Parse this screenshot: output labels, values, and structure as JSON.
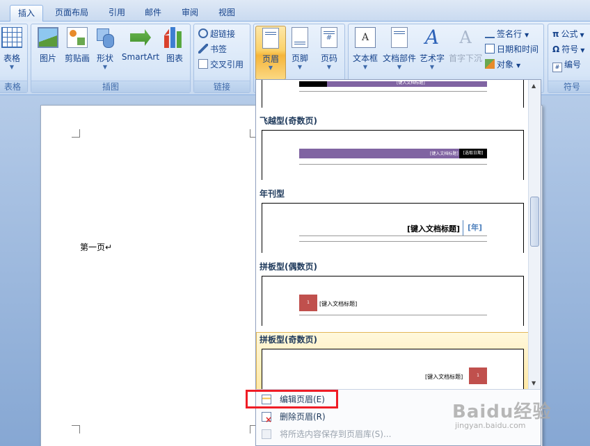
{
  "tabs": [
    {
      "label": "插入",
      "active": true
    },
    {
      "label": "页面布局"
    },
    {
      "label": "引用"
    },
    {
      "label": "邮件"
    },
    {
      "label": "审阅"
    },
    {
      "label": "视图"
    }
  ],
  "ribbon": {
    "table": {
      "label": "表格",
      "group": "表格"
    },
    "illustrations": {
      "group": "插图",
      "picture": "图片",
      "clipart": "剪贴画",
      "shapes": "形状",
      "smartart": "SmartArt",
      "chart": "图表"
    },
    "links": {
      "group": "链接",
      "hyperlink": "超链接",
      "bookmark": "书签",
      "crossref": "交叉引用"
    },
    "header_footer": {
      "header": "页眉",
      "footer": "页脚",
      "pagenumber": "页码"
    },
    "text": {
      "textbox": "文本框",
      "quickparts": "文档部件",
      "wordart": "艺术字",
      "dropcap": "首字下沉",
      "signature": "签名行",
      "datetime": "日期和时间",
      "object": "对象"
    },
    "symbols": {
      "group": "符号",
      "equation": "公式",
      "symbol": "符号",
      "number": "编号"
    }
  },
  "document": {
    "text": "第一页↵"
  },
  "gallery": {
    "items": [
      {
        "title": "飞越型(奇数页)",
        "preview": [
          "[键入文档标题]",
          "[选取日期]"
        ]
      },
      {
        "title": "年刊型",
        "preview": [
          "[键入文档标题]",
          "[年]"
        ]
      },
      {
        "title": "拼板型(偶数页)",
        "preview": [
          "1",
          "[键入文档标题]"
        ]
      },
      {
        "title": "拼板型(奇数页)",
        "preview": [
          "[键入文档标题]",
          "1"
        ]
      }
    ],
    "top_preview": "[键入文档标题]"
  },
  "menu": {
    "edit_header": "编辑页眉(E)",
    "remove_header": "删除页眉(R)",
    "save_selection": "将所选内容保存到页眉库(S)..."
  },
  "watermark": {
    "brand": "Baidu经验",
    "url": "jingyan.baidu.com"
  },
  "colors": {
    "highlight": "#ef1c25",
    "purple": "#8064a2",
    "red_block": "#c0504d"
  }
}
